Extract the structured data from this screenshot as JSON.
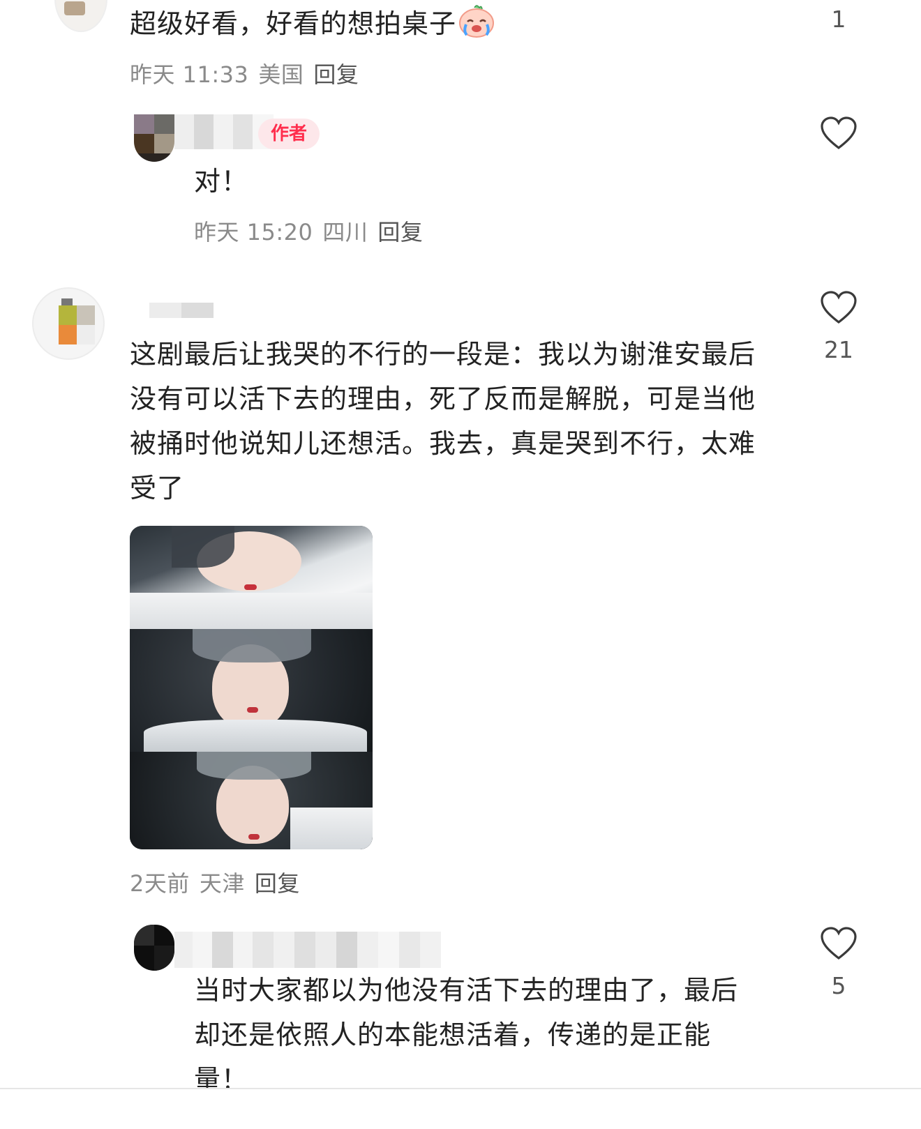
{
  "comments": [
    {
      "text": "超级好看，好看的想拍桌子",
      "emoji": "crying-face-emoji",
      "time": "昨天 11:33",
      "location": "美国",
      "reply_label": "回复",
      "likes": "1"
    },
    {
      "author_badge": "作者",
      "text": "对！",
      "time": "昨天 15:20",
      "location": "四川",
      "reply_label": "回复"
    },
    {
      "text_lines": [
        "这剧最后让我哭的不行的一段是：我以为谢淮安最后",
        "没有可以活下去的理由，死了反而是解脱，可是当他",
        "被捅时他说知儿还想活。我去，真是哭到不行，太难",
        "受了"
      ],
      "time": "2天前",
      "location": "天津",
      "reply_label": "回复",
      "likes": "21",
      "image": "triptych-photo"
    },
    {
      "text_lines": [
        "当时大家都以为他没有活下去的理由了，最后",
        "却还是依照人的本能想活着，传递的是正能",
        "量！"
      ],
      "likes": "5"
    }
  ],
  "colors": {
    "badge_bg": "#fde7ea",
    "badge_text": "#ff2e4d",
    "meta_text": "#8a8a8a",
    "body_text": "#222222"
  }
}
